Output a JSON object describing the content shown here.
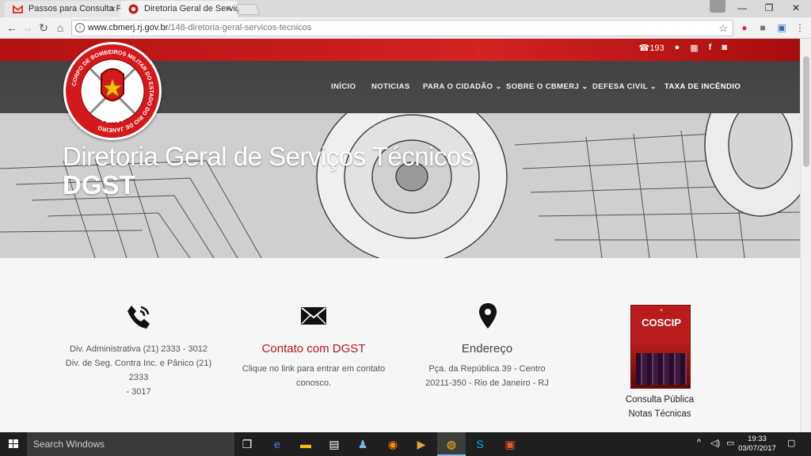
{
  "browser": {
    "tabs": [
      {
        "title": "Passos para Consulta Pú",
        "icon": "gmail-icon"
      },
      {
        "title": "Diretoria Geral de Serviç",
        "icon": "cbmerj-seal-icon"
      }
    ],
    "url_host": "www.cbmerj.rj.gov.br",
    "url_path": "/148-diretoria-geral-servicos-tecnicos",
    "close_glyph": "×"
  },
  "site": {
    "top_phone": "193",
    "menu": [
      {
        "label": "INÍCIO"
      },
      {
        "label": "NOTICIAS"
      },
      {
        "label": "PARA O CIDADÃO ⌄"
      },
      {
        "label": "SOBRE O CBMERJ ⌄"
      },
      {
        "label": "DEFESA CIVIL ⌄"
      },
      {
        "label": "TAXA DE INCÊNDIO"
      }
    ],
    "seal_text": "CORPO DE BOMBEIROS MILITAR DO ESTADO DO RIO DE JANEIRO",
    "seal_year": "- 1856 -",
    "hero_title": "Diretoria Geral de Serviços Técnicos",
    "hero_subtitle": "DGST"
  },
  "contact": {
    "phone_line1": "Div. Administrativa (21) 2333 - 3012",
    "phone_line2": "Div. de Seg. Contra Inc. e Pânico (21) 2333",
    "phone_line3": "- 3017",
    "email_title": "Contato com DGST",
    "email_line1": "Clique no link para entrar em contato",
    "email_line2": "conosco.",
    "address_title": "Endereço",
    "address_line1": "Pça. da República 39 - Centro",
    "address_line2": "20211-350 - Rio de Janeiro - RJ",
    "coscip_cover_title": "COSCIP",
    "coscip_label1": "Consulta Pública",
    "coscip_label2": "Notas Técnicas"
  },
  "taskbar": {
    "search_placeholder": "Search Windows",
    "time": "19:33",
    "date": "03/07/2017"
  },
  "colors": {
    "accent_red": "#b3191b",
    "text_gray": "#555555"
  }
}
